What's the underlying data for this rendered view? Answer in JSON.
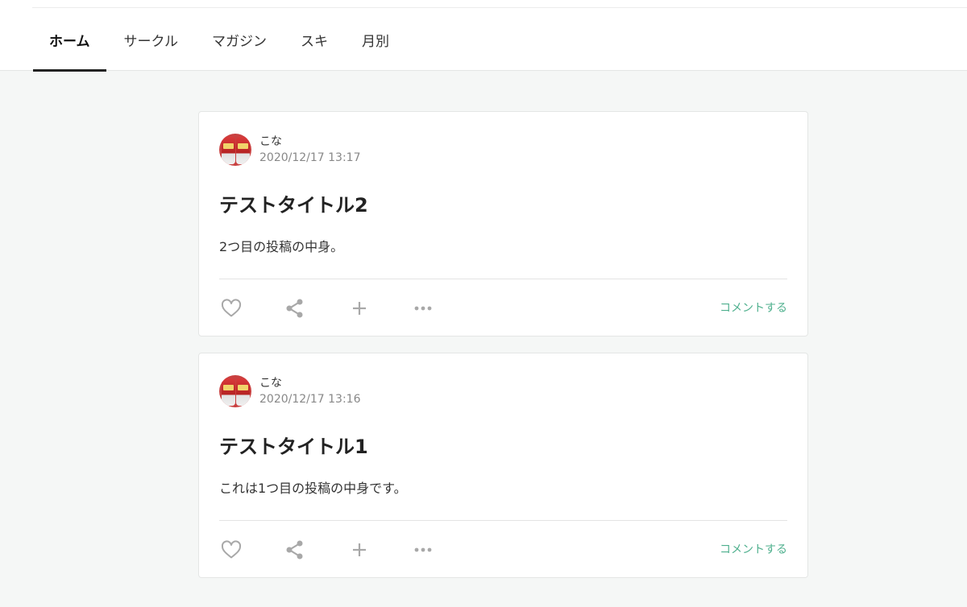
{
  "nav": {
    "tabs": [
      {
        "label": "ホーム",
        "active": true
      },
      {
        "label": "サークル",
        "active": false
      },
      {
        "label": "マガジン",
        "active": false
      },
      {
        "label": "スキ",
        "active": false
      },
      {
        "label": "月別",
        "active": false
      }
    ]
  },
  "posts": [
    {
      "author": "こな",
      "date": "2020/12/17 13:17",
      "title": "テストタイトル2",
      "body": "2つ目の投稿の中身。",
      "comment_label": "コメントする",
      "icons": [
        "heart-icon",
        "share-icon",
        "plus-icon",
        "more-icon"
      ]
    },
    {
      "author": "こな",
      "date": "2020/12/17 13:16",
      "title": "テストタイトル1",
      "body": "これは1つ目の投稿の中身です。",
      "comment_label": "コメントする",
      "icons": [
        "heart-icon",
        "share-icon",
        "plus-icon",
        "more-icon"
      ]
    }
  ],
  "colors": {
    "accent": "#4fb08e",
    "background": "#f5f7f6",
    "icon": "#a8a8a8"
  }
}
